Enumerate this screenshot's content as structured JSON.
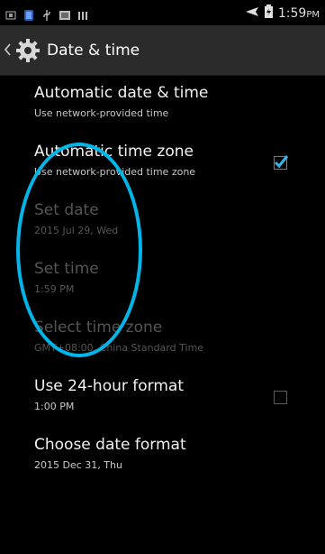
{
  "status_bar": {
    "time": "1:59",
    "ampm": "PM",
    "icons": [
      "sim-icon",
      "app-icon",
      "usb-icon",
      "image-icon",
      "bars-icon",
      "airplane-mode-icon",
      "battery-icon"
    ]
  },
  "action_bar": {
    "title": "Date & time",
    "back_icon": "chevron-left-icon",
    "app_icon": "gear-icon"
  },
  "settings": [
    {
      "title": "Automatic date & time",
      "summary": "Use network-provided time",
      "enabled": true,
      "checkbox": null
    },
    {
      "title": "Automatic time zone",
      "summary": "Use network-provided time zone",
      "enabled": true,
      "checkbox": "checked"
    },
    {
      "title": "Set date",
      "summary": "2015 Jul 29, Wed",
      "enabled": false,
      "checkbox": null
    },
    {
      "title": "Set time",
      "summary": "1:59 PM",
      "enabled": false,
      "checkbox": null
    },
    {
      "title": "Select time zone",
      "summary": "GMT+08:00, China Standard Time",
      "enabled": false,
      "checkbox": null
    },
    {
      "title": "Use 24-hour format",
      "summary": "1:00 PM",
      "enabled": true,
      "checkbox": "unchecked"
    },
    {
      "title": "Choose date format",
      "summary": "2015 Dec 31, Thu",
      "enabled": true,
      "checkbox": null
    }
  ],
  "colors": {
    "accent": "#33b5e5",
    "annotation": "#00b6e8",
    "background": "#000000",
    "disabled_text": "#555555"
  }
}
